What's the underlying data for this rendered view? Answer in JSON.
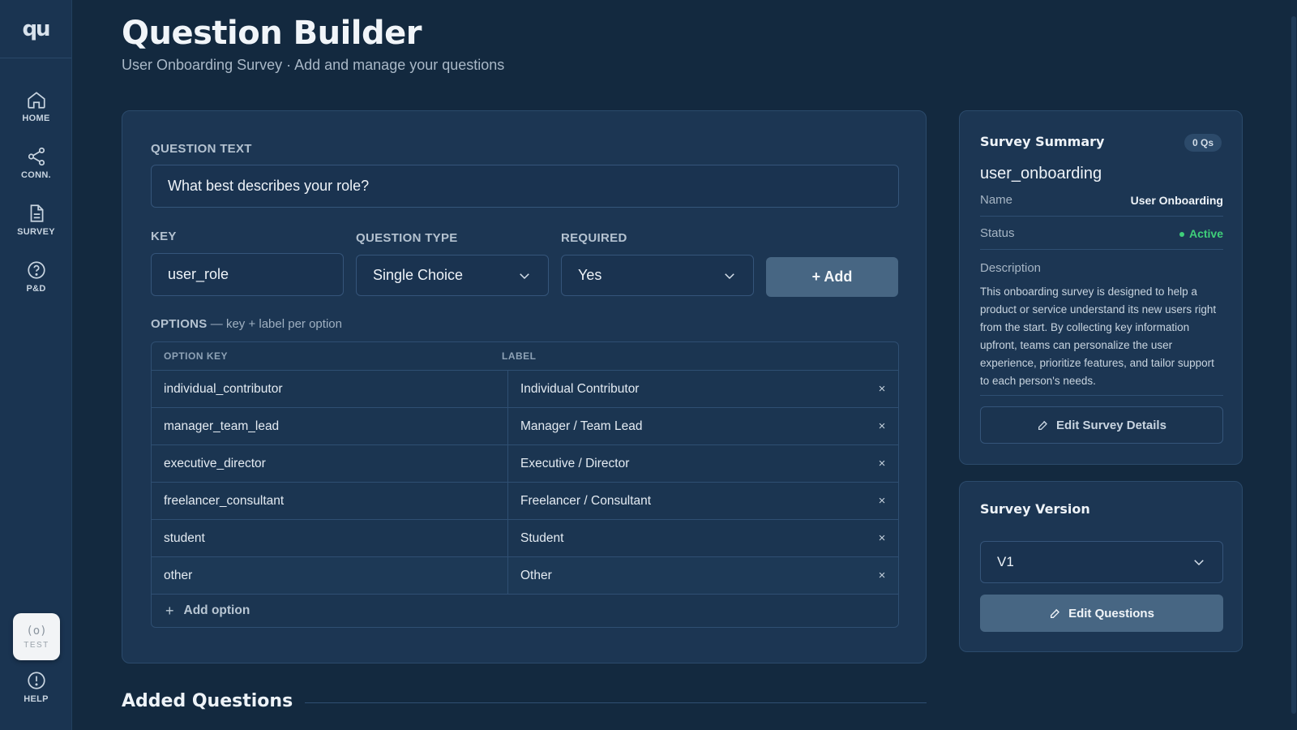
{
  "sidebar": {
    "logo": "qu",
    "items": [
      {
        "label": "HOME",
        "icon": "home-icon"
      },
      {
        "label": "CONN.",
        "icon": "share-icon"
      },
      {
        "label": "SURVEY",
        "icon": "document-icon"
      },
      {
        "label": "P&D",
        "icon": "help-circle-icon"
      }
    ],
    "test": {
      "glyph": "(o)",
      "label": "TEST"
    },
    "help": {
      "label": "HELP",
      "icon": "info-icon"
    }
  },
  "header": {
    "title": "Question Builder",
    "subtitle": "User Onboarding Survey · Add and manage your questions"
  },
  "builder": {
    "question_text_label": "QUESTION TEXT",
    "question_text_value": "What best describes your role?",
    "key_label": "KEY",
    "key_value": "user_role",
    "type_label": "QUESTION TYPE",
    "type_value": "Single Choice",
    "required_label": "REQUIRED",
    "required_value": "Yes",
    "add_button": "+ Add",
    "options_heading": "OPTIONS",
    "options_hint": "— key + label per option",
    "columns": [
      "OPTION KEY",
      "LABEL"
    ],
    "options": [
      {
        "key": "individual_contributor",
        "label": "Individual Contributor"
      },
      {
        "key": "manager_team_lead",
        "label": "Manager / Team Lead"
      },
      {
        "key": "executive_director",
        "label": "Executive / Director"
      },
      {
        "key": "freelancer_consultant",
        "label": "Freelancer / Consultant"
      },
      {
        "key": "student",
        "label": "Student"
      },
      {
        "key": "other",
        "label": "Other"
      }
    ],
    "remove_glyph": "×",
    "add_option": "Add option",
    "add_option_glyph": "+"
  },
  "added_questions": {
    "title": "Added Questions"
  },
  "summary": {
    "title": "Survey Summary",
    "badge": "0 Qs",
    "survey_key": "user_onboarding",
    "name_label": "Name",
    "name_value": "User Onboarding",
    "status_label": "Status",
    "status_value": "Active",
    "status_color": "#3fcf7a",
    "description_label": "Description",
    "description": "This onboarding survey is designed to help a product or service understand its new users right from the start. By collecting key information upfront, teams can personalize the user experience, prioritize features, and tailor support to each person's needs.",
    "edit_button": "Edit Survey Details"
  },
  "version": {
    "title": "Survey Version",
    "selected": "V1",
    "edit_button": "Edit Questions"
  },
  "colors": {
    "background": "#13293f",
    "card": "#1c3653",
    "accent_button": "#476683"
  }
}
